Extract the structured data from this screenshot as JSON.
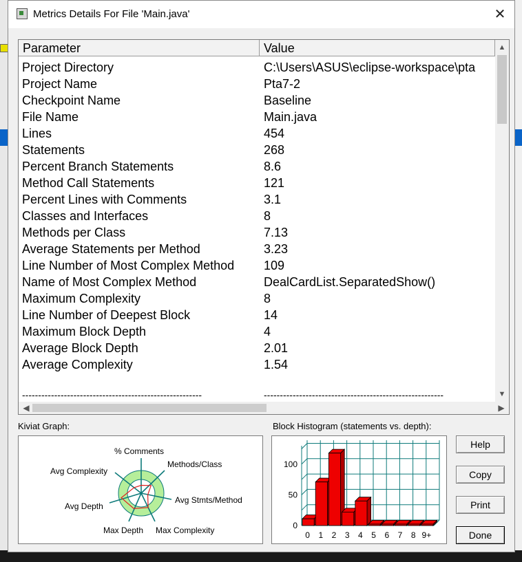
{
  "window": {
    "title": "Metrics Details For File 'Main.java'",
    "close_glyph": "✕"
  },
  "table": {
    "headers": {
      "parameter": "Parameter",
      "value": "Value"
    },
    "rows": [
      {
        "parameter": "Project Directory",
        "value": "C:\\Users\\ASUS\\eclipse-workspace\\pta"
      },
      {
        "parameter": "Project Name",
        "value": "Pta7-2"
      },
      {
        "parameter": "Checkpoint Name",
        "value": "Baseline"
      },
      {
        "parameter": "File Name",
        "value": "Main.java"
      },
      {
        "parameter": "Lines",
        "value": "454"
      },
      {
        "parameter": "Statements",
        "value": "268"
      },
      {
        "parameter": "Percent Branch Statements",
        "value": "8.6"
      },
      {
        "parameter": "Method Call Statements",
        "value": "121"
      },
      {
        "parameter": "Percent Lines with Comments",
        "value": "3.1"
      },
      {
        "parameter": "Classes and Interfaces",
        "value": "8"
      },
      {
        "parameter": "Methods per Class",
        "value": "7.13"
      },
      {
        "parameter": "Average Statements per Method",
        "value": "3.23"
      },
      {
        "parameter": "Line Number of Most Complex Method",
        "value": "109"
      },
      {
        "parameter": "Name of Most Complex Method",
        "value": "DealCardList.SeparatedShow()"
      },
      {
        "parameter": "Maximum Complexity",
        "value": "8"
      },
      {
        "parameter": "Line Number of Deepest Block",
        "value": "14"
      },
      {
        "parameter": "Maximum Block Depth",
        "value": "4"
      },
      {
        "parameter": "Average Block Depth",
        "value": "2.01"
      },
      {
        "parameter": "Average Complexity",
        "value": "1.54"
      }
    ],
    "separator_parameter": "--------------------------------------------------------",
    "separator_value": "--------------------------------------------------------"
  },
  "kiviat": {
    "label": "Kiviat Graph:",
    "axes": {
      "comments": "% Comments",
      "methods_class": "Methods/Class",
      "avg_stmts_method": "Avg Stmts/Method",
      "max_complexity": "Max Complexity",
      "max_depth": "Max Depth",
      "avg_depth": "Avg Depth",
      "avg_complexity": "Avg Complexity"
    },
    "colors": {
      "outer_ring": "#b6ee9a",
      "inner_ring": "#ffffff",
      "axis": "#0d7a7a",
      "polygon": "#e02020"
    }
  },
  "histogram": {
    "label": "Block Histogram (statements vs. depth):",
    "bar_color": "#ee0000",
    "grid_color": "#0d7a7a"
  },
  "chart_data": {
    "type": "bar",
    "categories": [
      "0",
      "1",
      "2",
      "3",
      "4",
      "5",
      "6",
      "7",
      "8",
      "9+"
    ],
    "values": [
      11,
      71,
      118,
      22,
      40,
      0,
      0,
      0,
      0,
      0
    ],
    "yticks": [
      "0",
      "50",
      "100"
    ],
    "ylim": [
      0,
      130
    ],
    "grid": true
  },
  "buttons": {
    "help": "Help",
    "copy": "Copy",
    "print": "Print",
    "done": "Done"
  }
}
